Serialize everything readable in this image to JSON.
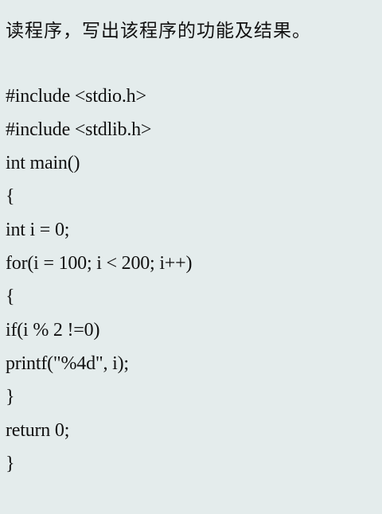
{
  "question": {
    "title": "读程序，写出该程序的功能及结果。"
  },
  "code": {
    "lines": [
      "#include <stdio.h>",
      "#include <stdlib.h>",
      "int main()",
      "{",
      "int i = 0;",
      "for(i = 100; i < 200; i++)",
      "{",
      "if(i % 2 !=0)",
      "printf(\"%4d\", i);",
      "}",
      "return 0;",
      "}"
    ]
  }
}
